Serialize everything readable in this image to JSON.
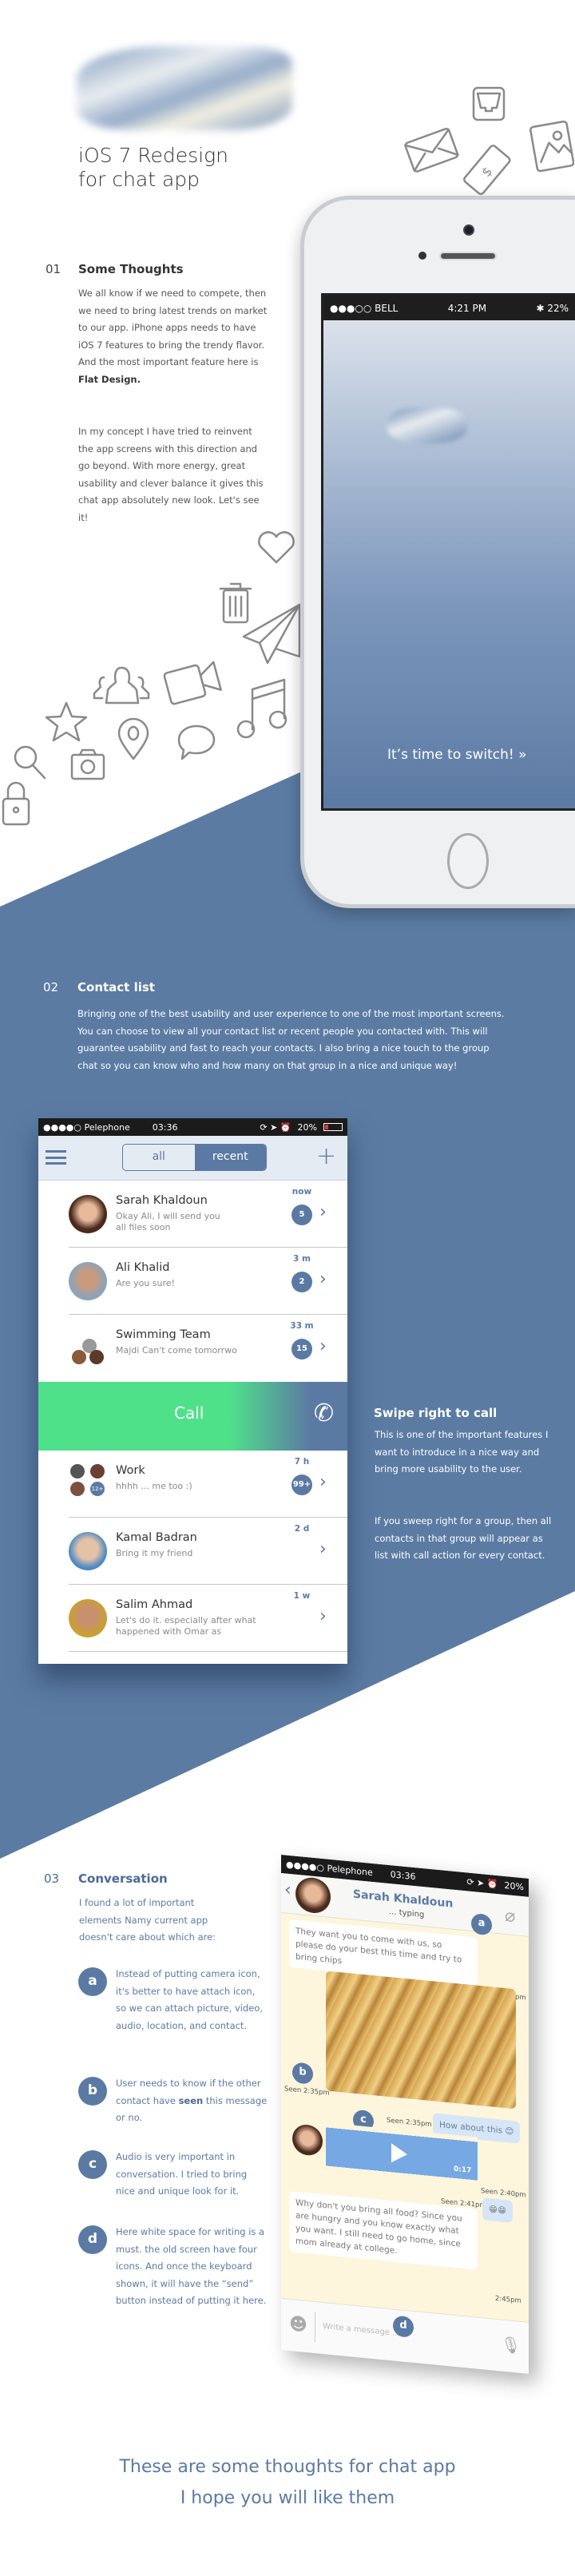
{
  "colors": {
    "accent": "#5b7aa3",
    "call_green": "#4fe08a",
    "chat_bg": "#fdf6dd"
  },
  "hero": {
    "title_line1": "iOS 7 Redesign",
    "title_line2": "for chat app",
    "phone": {
      "carrier": "●●●○○ BELL",
      "time": "4:21 PM",
      "battery": "22%",
      "cta": "It’s time to switch! »"
    }
  },
  "section1": {
    "number": "01",
    "heading": "Some Thoughts",
    "p1": "We all know if we need to compete, then we need to bring latest trends on market to our app. iPhone apps needs to have iOS 7 features to bring the trendy flavor. And the most important feature here is",
    "p1_bold": "Flat Design.",
    "p2": "In my concept I have tried to reinvent the app screens with this direction and go beyond. With more energy, great usability and clever balance it gives this chat app absolutely new look. Let's see it!"
  },
  "section2": {
    "number": "02",
    "heading": "Contact list",
    "p": "Bringing one of the best usability and user experience to one of the most important screens. You can choose to view all your contact list or recent people you contacted with. This will guarantee usability and fast to reach your contacts. I also bring a nice touch to the group chat so you can know who and how many on that group in a nice and unique way!",
    "swipe_heading": "Swipe right to call",
    "swipe_p1": "This is one of the important features I want to introduce in a nice way and bring more usability to the user.",
    "swipe_p2": "If you sweep right for a group, then all contacts in that group will appear as list with call action for every contact."
  },
  "contact_app": {
    "carrier": "●●●●○ Pelephone",
    "time": "03:36",
    "battery": "20%",
    "tabs": [
      "all",
      "recent"
    ],
    "active_tab": "recent",
    "call_label": "Call",
    "contacts": [
      {
        "name": "Sarah Khaldoun",
        "message": "Okay Ali, I will send you all files soon",
        "time": "now",
        "badge": "5"
      },
      {
        "name": "Ali Khalid",
        "message": "Are you sure!",
        "time": "3 m",
        "badge": "2"
      },
      {
        "name": "Swimming Team",
        "message": "Majdi Can't come tomorrwo",
        "time": "33 m",
        "badge": "15"
      },
      {
        "name": "Work",
        "message": "hhhh ... me too :)",
        "time": "7 h",
        "badge": "99+",
        "group_extra": "12+"
      },
      {
        "name": "Kamal Badran",
        "message": "Bring it my friend",
        "time": "2 d"
      },
      {
        "name": "Salim Ahmad",
        "message": "Let's do it. especially after what happened with Omar as",
        "time": "1 w"
      }
    ]
  },
  "section3": {
    "number": "03",
    "heading": "Conversation",
    "intro": "I found a lot of important elements Namy current app doesn't care about which are:",
    "items": [
      {
        "label": "a",
        "text": "Instead of putting camera icon, it's better to have attach icon, so we can  attach picture, video, audio, location, and contact."
      },
      {
        "label": "b",
        "text_before": "User needs to know if the other contact have",
        "bold": "seen",
        "text_after": "this message or no."
      },
      {
        "label": "c",
        "text": "Audio is very important in conversation. I tried to bring nice and unique look for it."
      },
      {
        "label": "d",
        "text": "Here white space for writing is a must. the old screen have four icons. And once the keyboard shown, it will have the “send” button instead of putting it here."
      }
    ]
  },
  "chat_app": {
    "carrier": "●●●●○ Pelephone",
    "time": "03:36",
    "battery": "20%",
    "contact": "Sarah Khaldoun",
    "status": "... typing",
    "messages": {
      "m1": "They want you to come with us, so please do your best this time and try to bring chips",
      "seen1": "Seen 2:34pm",
      "seen2": "Seen 2:35pm",
      "seen3": "Seen 2:35pm",
      "m2": "How about this 😊",
      "audio_duration": "0:17",
      "seen4": "Seen 2:40pm",
      "seen5": "Seen 2:41pm",
      "m3": "😁😁",
      "m4": "Why don't you bring all food? Since you are hungry and you know exactly what you want. I still need to go home, since mom already at college.",
      "time4": "2:45pm"
    },
    "input_placeholder": "Write a message ..."
  },
  "footer": {
    "line1": "These are some thoughts for chat app",
    "line2": "I hope you will like them"
  }
}
